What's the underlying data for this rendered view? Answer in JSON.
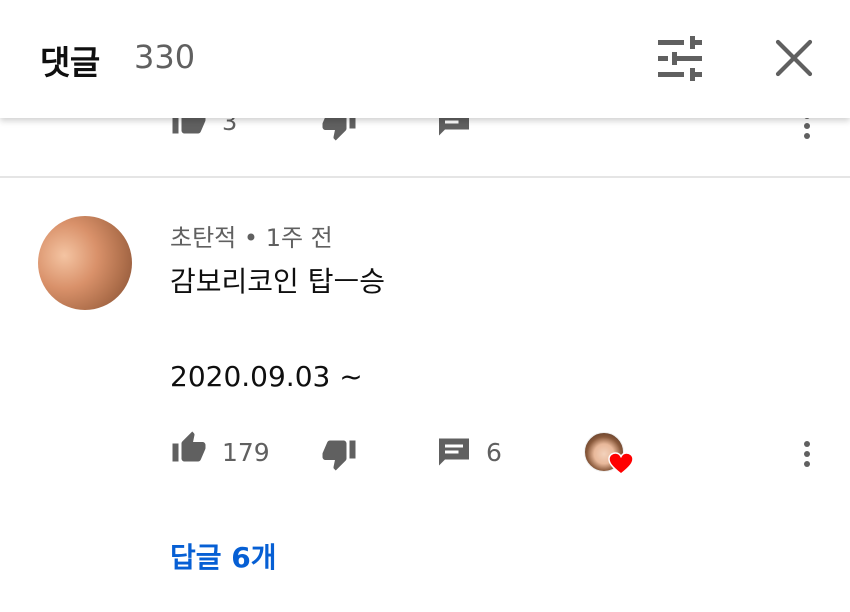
{
  "header": {
    "title": "댓글",
    "count": "330",
    "filter_icon": "tune-icon",
    "close_icon": "close-icon"
  },
  "previous_comment": {
    "like_count": "3"
  },
  "comment": {
    "author": "초탄적",
    "separator": "•",
    "time": "1주 전",
    "text_line1": "감보리코인 탑ㅡ승",
    "text_line2": "2020.09.03 ~",
    "like_count": "179",
    "reply_count": "6"
  },
  "replies_link": "답글 6개",
  "colors": {
    "link": "#065fd4",
    "secondary_text": "#606060",
    "icon": "#606060",
    "heart": "#ff0000"
  }
}
